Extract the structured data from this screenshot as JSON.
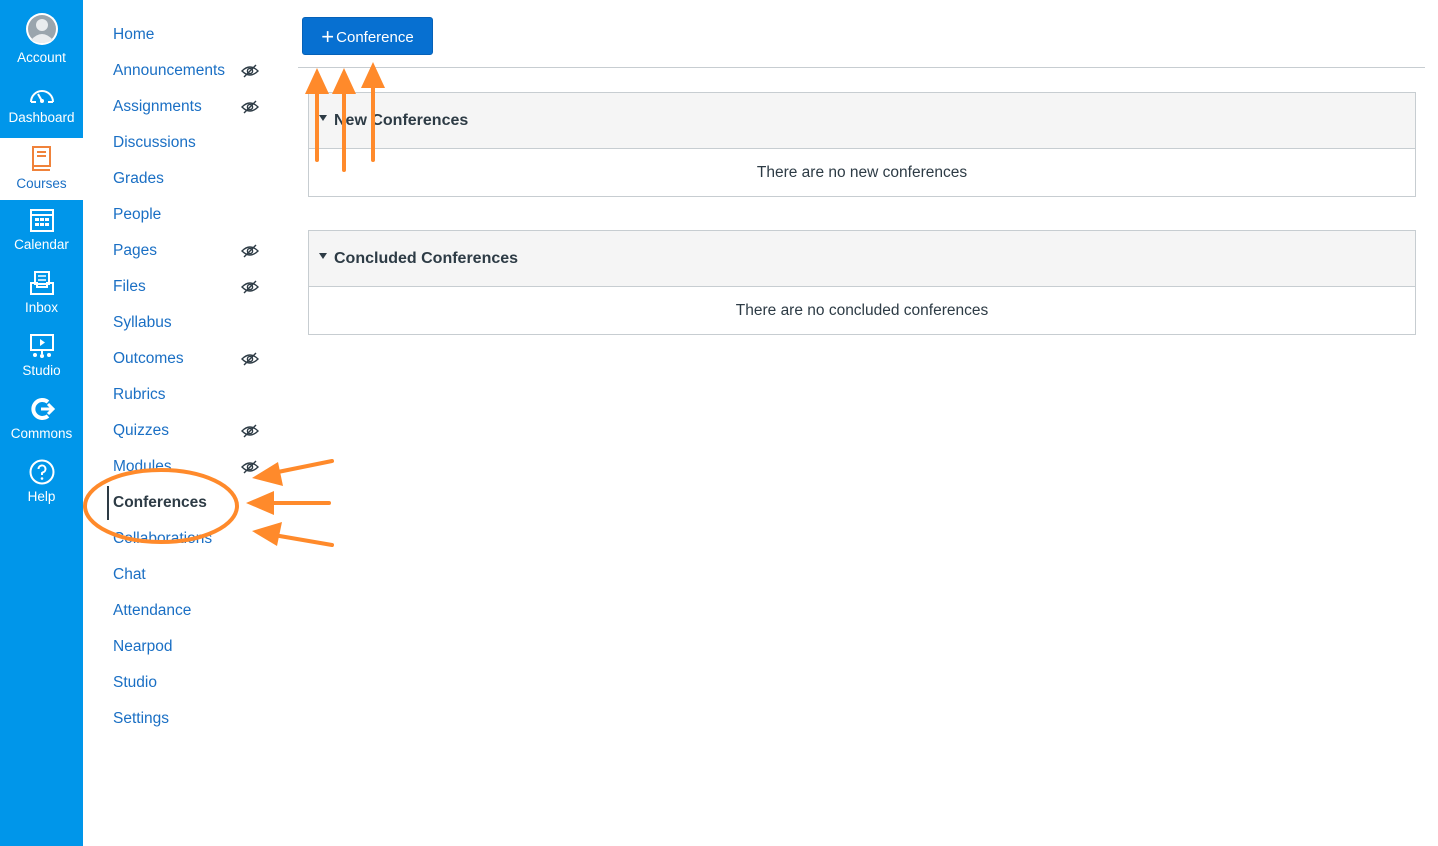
{
  "global_nav": {
    "items": [
      {
        "label": "Account",
        "icon": "user-avatar-icon"
      },
      {
        "label": "Dashboard",
        "icon": "speedometer-icon"
      },
      {
        "label": "Courses",
        "icon": "book-icon",
        "active": true
      },
      {
        "label": "Calendar",
        "icon": "calendar-icon"
      },
      {
        "label": "Inbox",
        "icon": "inbox-icon"
      },
      {
        "label": "Studio",
        "icon": "studio-icon"
      },
      {
        "label": "Commons",
        "icon": "commons-icon"
      },
      {
        "label": "Help",
        "icon": "help-icon"
      }
    ],
    "bg_color": "#0096ea",
    "active_color": "#1a6fc4"
  },
  "course_nav": {
    "items": [
      {
        "label": "Home"
      },
      {
        "label": "Announcements",
        "hidden": true
      },
      {
        "label": "Assignments",
        "hidden": true
      },
      {
        "label": "Discussions"
      },
      {
        "label": "Grades"
      },
      {
        "label": "People"
      },
      {
        "label": "Pages",
        "hidden": true
      },
      {
        "label": "Files",
        "hidden": true
      },
      {
        "label": "Syllabus"
      },
      {
        "label": "Outcomes",
        "hidden": true
      },
      {
        "label": "Rubrics"
      },
      {
        "label": "Quizzes",
        "hidden": true
      },
      {
        "label": "Modules",
        "hidden": true
      },
      {
        "label": "Conferences",
        "active": true
      },
      {
        "label": "Collaborations"
      },
      {
        "label": "Chat"
      },
      {
        "label": "Attendance"
      },
      {
        "label": "Nearpod"
      },
      {
        "label": "Studio"
      },
      {
        "label": "Settings"
      }
    ],
    "hidden_icon": "eye-slash-icon",
    "link_color": "#1a6fc4"
  },
  "toolbar": {
    "add_button_label": "Conference",
    "add_button_icon": "plus-icon",
    "button_color": "#0770d1"
  },
  "sections": {
    "new": {
      "title": "New Conferences",
      "empty_text": "There are no new conferences"
    },
    "concluded": {
      "title": "Concluded Conferences",
      "empty_text": "There are no concluded conferences"
    }
  },
  "annotations": {
    "color": "#ff8a2b"
  }
}
